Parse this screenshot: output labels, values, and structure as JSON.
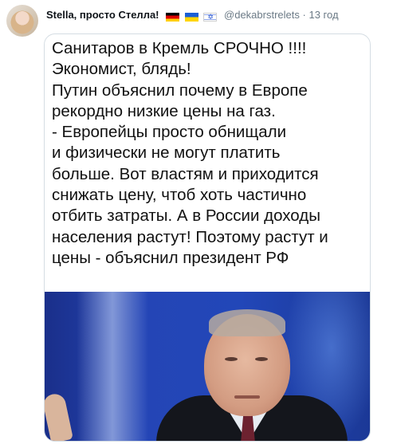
{
  "tweet": {
    "display_name": "Stella, просто Стелла!",
    "flags": [
      "flag-germany-icon",
      "flag-ukraine-icon",
      "flag-israel-icon"
    ],
    "username": "@dekabrstrelets",
    "separator": "·",
    "time": "13 год"
  },
  "media": {
    "text_lines": [
      "Санитаров в Кремль СРОЧНО !!!!",
      "Экономист, блядь!",
      "Путин объяснил почему в Европе",
      "рекордно низкие цены на газ.",
      "- Европейцы просто обнищали",
      "и физически не могут платить",
      "больше. Вот властям и приходится",
      "снижать цену, чтоб хоть частично",
      "отбить затраты. А в России доходы",
      "населения растут! Поэтому растут и",
      "цены - объяснил президент РФ"
    ],
    "colors": {
      "photo_background": "#2445b6",
      "card_border": "#d5dde3",
      "secondary_text": "#6b7a86"
    }
  }
}
